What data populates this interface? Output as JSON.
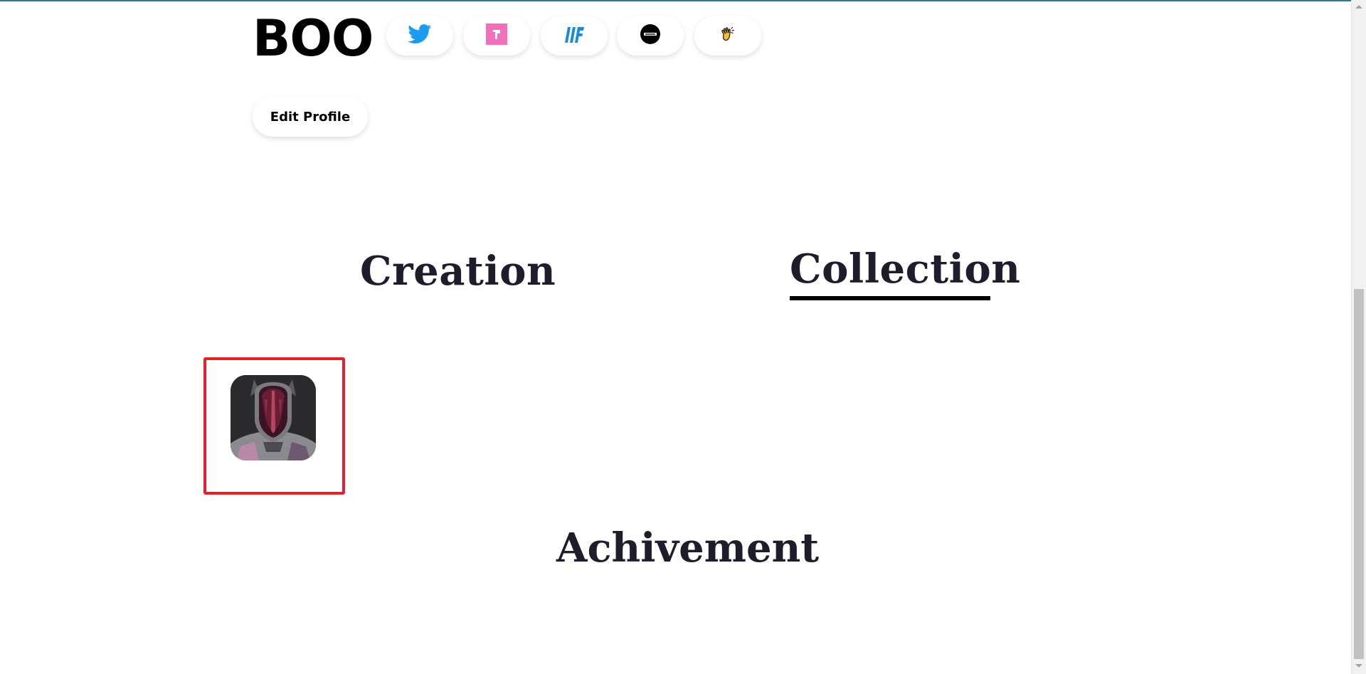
{
  "profile": {
    "name": "BOO",
    "edit_button": "Edit Profile",
    "social_icons": [
      "twitter-icon",
      "foundation-icon",
      "mintable-icon",
      "opensea-icon",
      "rarible-clap-icon"
    ]
  },
  "tabs": [
    {
      "label": "Creation",
      "active": false
    },
    {
      "label": "Collection",
      "active": true
    }
  ],
  "collection": {
    "items": [
      {
        "name": "robot-avatar-nft"
      }
    ]
  },
  "achievements": {
    "title": "Achivement"
  },
  "colors": {
    "twitter": "#1d9bf0",
    "foundation": "#f36ebd",
    "mintable": "#1c8bd6",
    "highlight": "#e5202a",
    "heading": "#1f1d2b",
    "top_line": "#2f7d86"
  }
}
